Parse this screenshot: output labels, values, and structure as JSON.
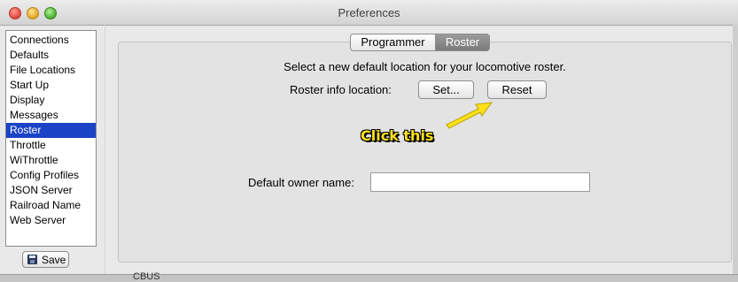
{
  "window": {
    "title": "Preferences"
  },
  "sidebar": {
    "items": [
      {
        "label": "Connections",
        "selected": false
      },
      {
        "label": "Defaults",
        "selected": false
      },
      {
        "label": "File Locations",
        "selected": false
      },
      {
        "label": "Start Up",
        "selected": false
      },
      {
        "label": "Display",
        "selected": false
      },
      {
        "label": "Messages",
        "selected": false
      },
      {
        "label": "Roster",
        "selected": true
      },
      {
        "label": "Throttle",
        "selected": false
      },
      {
        "label": "WiThrottle",
        "selected": false
      },
      {
        "label": "Config Profiles",
        "selected": false
      },
      {
        "label": "JSON Server",
        "selected": false
      },
      {
        "label": "Railroad Name",
        "selected": false
      },
      {
        "label": "Web Server",
        "selected": false
      }
    ],
    "save_label": "Save",
    "save_icon": "floppy-disk-icon"
  },
  "tabs": [
    {
      "label": "Programmer",
      "active": false
    },
    {
      "label": "Roster",
      "active": true
    }
  ],
  "roster_panel": {
    "instruction": "Select a new default location for your locomotive roster.",
    "location_label": "Roster info location:",
    "set_button": "Set...",
    "reset_button": "Reset",
    "owner_label": "Default owner name:",
    "owner_value": ""
  },
  "annotation": {
    "text": "Click this",
    "color": "#ffe11a"
  },
  "colors": {
    "selection": "#1b43c6",
    "active_tab": "#8a8a8a"
  },
  "background_window": {
    "partial_text": "CBUS"
  }
}
